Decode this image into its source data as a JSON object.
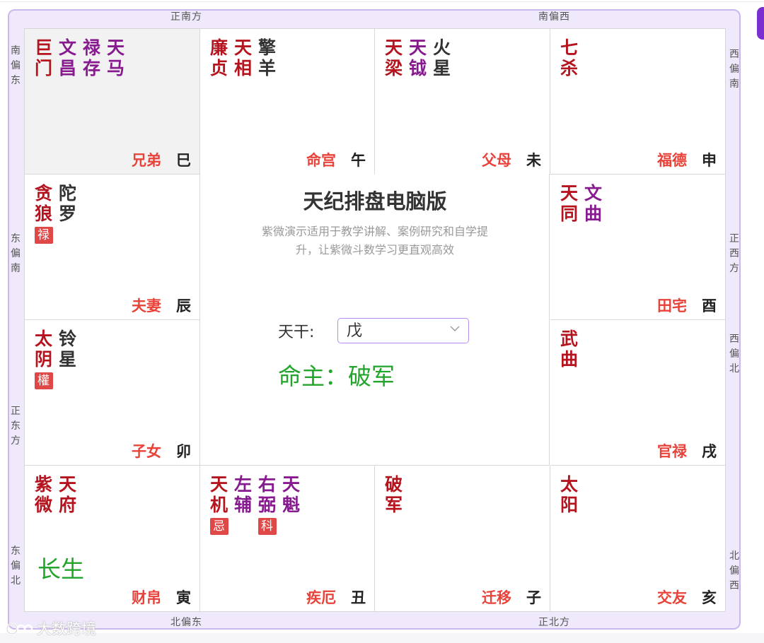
{
  "colors": {
    "major_star": "#b5141e",
    "minor_star": "#861a8e",
    "misc_star": "#333333",
    "palace_name": "#e8433a",
    "branch": "#222222",
    "mark_bg": "#e04848",
    "stage": "#22a52b",
    "accent": "#7b2fd0"
  },
  "directions": {
    "top_left": "正南方",
    "top_right": "南偏西",
    "bottom_left": "北偏东",
    "bottom_right": "正北方",
    "left_1": "南偏东",
    "left_2": "东偏南",
    "left_3": "正东方",
    "left_4": "东偏北",
    "right_1": "西偏南",
    "right_2": "正西方",
    "right_3": "西偏北",
    "right_4": "北偏西"
  },
  "palaces": {
    "si": {
      "name": "兄弟",
      "branch": "巳",
      "highlight": true,
      "stars": [
        {
          "top": "巨",
          "bottom": "门",
          "kind": "major",
          "mark": ""
        },
        {
          "top": "文",
          "bottom": "昌",
          "kind": "minor",
          "mark": ""
        },
        {
          "top": "禄",
          "bottom": "存",
          "kind": "minor",
          "mark": ""
        },
        {
          "top": "天",
          "bottom": "马",
          "kind": "minor",
          "mark": ""
        }
      ]
    },
    "wu": {
      "name": "命宫",
      "branch": "午",
      "stars": [
        {
          "top": "廉",
          "bottom": "贞",
          "kind": "major",
          "mark": ""
        },
        {
          "top": "天",
          "bottom": "相",
          "kind": "major",
          "mark": ""
        },
        {
          "top": "擎",
          "bottom": "羊",
          "kind": "misc",
          "mark": ""
        }
      ]
    },
    "wei": {
      "name": "父母",
      "branch": "未",
      "stars": [
        {
          "top": "天",
          "bottom": "梁",
          "kind": "major",
          "mark": ""
        },
        {
          "top": "天",
          "bottom": "钺",
          "kind": "minor",
          "mark": ""
        },
        {
          "top": "火",
          "bottom": "星",
          "kind": "misc",
          "mark": ""
        }
      ]
    },
    "shen": {
      "name": "福德",
      "branch": "申",
      "stars": [
        {
          "top": "七",
          "bottom": "杀",
          "kind": "major",
          "mark": ""
        }
      ]
    },
    "chen": {
      "name": "夫妻",
      "branch": "辰",
      "stars": [
        {
          "top": "贪",
          "bottom": "狼",
          "kind": "major",
          "mark": "禄"
        },
        {
          "top": "陀",
          "bottom": "罗",
          "kind": "misc",
          "mark": ""
        }
      ]
    },
    "you": {
      "name": "田宅",
      "branch": "酉",
      "stars": [
        {
          "top": "天",
          "bottom": "同",
          "kind": "major",
          "mark": ""
        },
        {
          "top": "文",
          "bottom": "曲",
          "kind": "minor",
          "mark": ""
        }
      ]
    },
    "mao": {
      "name": "子女",
      "branch": "卯",
      "stars": [
        {
          "top": "太",
          "bottom": "阴",
          "kind": "major",
          "mark": "權"
        },
        {
          "top": "铃",
          "bottom": "星",
          "kind": "misc",
          "mark": ""
        }
      ]
    },
    "xu": {
      "name": "官禄",
      "branch": "戌",
      "stars": [
        {
          "top": "武",
          "bottom": "曲",
          "kind": "major",
          "mark": ""
        }
      ]
    },
    "yin": {
      "name": "财帛",
      "branch": "寅",
      "stage": "长生",
      "stars": [
        {
          "top": "紫",
          "bottom": "微",
          "kind": "major",
          "mark": ""
        },
        {
          "top": "天",
          "bottom": "府",
          "kind": "major",
          "mark": ""
        }
      ]
    },
    "chou": {
      "name": "疾厄",
      "branch": "丑",
      "stars": [
        {
          "top": "天",
          "bottom": "机",
          "kind": "major",
          "mark": "忌"
        },
        {
          "top": "左",
          "bottom": "辅",
          "kind": "minor",
          "mark": ""
        },
        {
          "top": "右",
          "bottom": "弼",
          "kind": "minor",
          "mark": "科"
        },
        {
          "top": "天",
          "bottom": "魁",
          "kind": "minor",
          "mark": ""
        }
      ]
    },
    "zi": {
      "name": "迁移",
      "branch": "子",
      "stars": [
        {
          "top": "破",
          "bottom": "军",
          "kind": "major",
          "mark": ""
        }
      ]
    },
    "hai": {
      "name": "交友",
      "branch": "亥",
      "stars": [
        {
          "top": "太",
          "bottom": "阳",
          "kind": "major",
          "mark": ""
        }
      ]
    }
  },
  "center": {
    "title": "天纪排盘电脑版",
    "description": "紫微演示适用于教学讲解、案例研究和自学提升，让紫微斗数学习更直观高效",
    "tiangan_label": "天干:",
    "tiangan_value": "戊",
    "mingzhu_label": "命主：破军"
  },
  "watermark": {
    "text": "大数跨境",
    "icon": "logo-icon"
  }
}
